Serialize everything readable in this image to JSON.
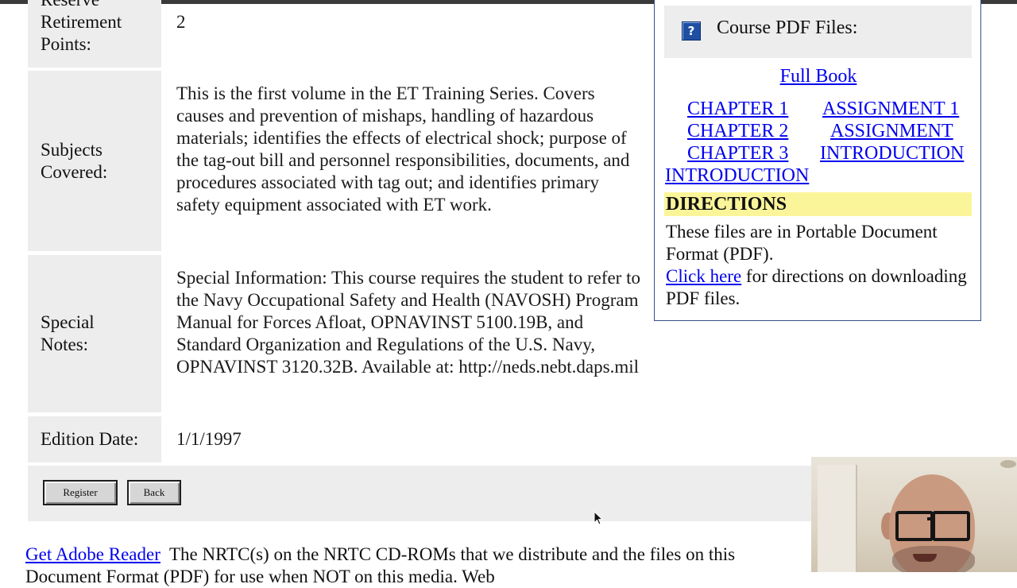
{
  "details": {
    "points": {
      "label_line1": "Reserve",
      "label_line2": "Retirement",
      "label_line3": "Points:",
      "value": "2"
    },
    "subjects": {
      "label_line1": "Subjects",
      "label_line2": "Covered:",
      "value": "This is the first volume in the ET Training Series. Covers causes and prevention of mishaps, handling of hazardous materials; identifies the effects of electrical shock; purpose of the tag-out bill and personnel responsibilities, documents, and procedures associated with tag out; and identifies primary safety equipment associated with ET work."
    },
    "notes": {
      "label_line1": "Special",
      "label_line2": "Notes:",
      "value": "Special Information: This course requires the student to refer to the Navy Occupational Safety and Health (NAVOSH) Program Manual for Forces Afloat, OPNAVINST 5100.19B, and Standard Organization and Regulations of the U.S. Navy, OPNAVINST 3120.32B. Available at: http://neds.nebt.daps.mil"
    },
    "edition": {
      "label": "Edition Date:",
      "value": "1/1/1997"
    }
  },
  "buttons": {
    "register": "Register",
    "back": "Back"
  },
  "pdf_panel": {
    "title": "Course PDF Files:",
    "full_book": "Full Book",
    "links": {
      "chapter1": "CHAPTER 1",
      "assignment1": "ASSIGNMENT 1",
      "chapter2": "CHAPTER 2",
      "assignment": "ASSIGNMENT",
      "chapter3": "CHAPTER 3",
      "introduction_right": "INTRODUCTION",
      "introduction_left": "INTRODUCTION"
    },
    "directions_heading": "DIRECTIONS",
    "directions_text": "These files are in Portable Document Format (PDF).",
    "click_here": "Click here",
    "click_here_suffix": " for directions on downloading PDF files."
  },
  "bottom": {
    "adobe_link": "Get Adobe Reader",
    "text_line1": "The NRTC(s) on the NRTC CD-ROMs that we distribute and the files on this",
    "text_line2": "Document Format (PDF) for use when NOT on this media. Web"
  },
  "icons": {
    "help": "help-icon",
    "cursor": "mouse-pointer-icon"
  },
  "colors": {
    "link": "#0000ee",
    "label_bg": "#ededed",
    "directions_bg": "#fbf59a",
    "panel_border": "#3b4f8a"
  }
}
